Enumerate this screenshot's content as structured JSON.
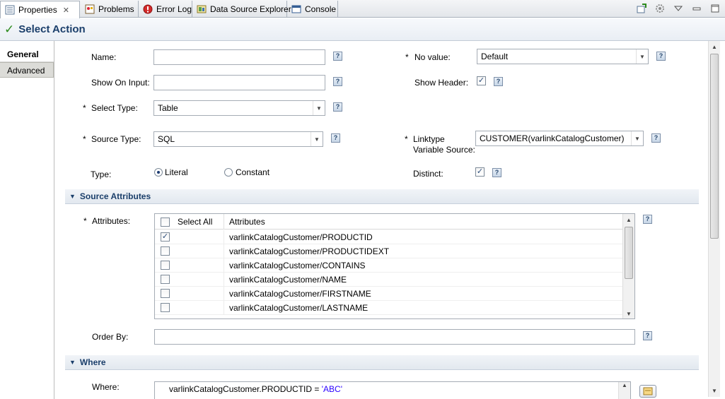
{
  "tabs": [
    {
      "label": "Properties",
      "icon": "properties-icon",
      "active": true,
      "closable": true
    },
    {
      "label": "Problems",
      "icon": "problems-icon"
    },
    {
      "label": "Error Log",
      "icon": "error-log-icon"
    },
    {
      "label": "Data Source Explorer",
      "icon": "data-source-explorer-icon"
    },
    {
      "label": "Console",
      "icon": "console-icon"
    }
  ],
  "title": "Select Action",
  "left_tabs": [
    {
      "label": "General",
      "selected": true
    },
    {
      "label": "Advanced",
      "selected": false
    }
  ],
  "form": {
    "name_label": "Name:",
    "name_value": "",
    "show_on_input_label": "Show On Input:",
    "show_on_input_value": "",
    "select_type_label": "Select Type:",
    "select_type_value": "Table",
    "source_type_label": "Source Type:",
    "source_type_value": "SQL",
    "type_label": "Type:",
    "type_options": [
      "Literal",
      "Constant"
    ],
    "type_selected": "Literal",
    "no_value_label": "No value:",
    "no_value_value": "Default",
    "show_header_label": "Show Header:",
    "show_header_checked": true,
    "linktype_label_1": "Linktype",
    "linktype_label_2": "Variable Source:",
    "linktype_value": "CUSTOMER(varlinkCatalogCustomer)",
    "distinct_label": "Distinct:",
    "distinct_checked": true,
    "required_mark": "*"
  },
  "source_attributes": {
    "section_title": "Source Attributes",
    "attributes_label": "Attributes:",
    "columns": [
      "Select All",
      "Attributes"
    ],
    "rows": [
      {
        "checked": true,
        "attribute": "varlinkCatalogCustomer/PRODUCTID"
      },
      {
        "checked": false,
        "attribute": "varlinkCatalogCustomer/PRODUCTIDEXT"
      },
      {
        "checked": false,
        "attribute": "varlinkCatalogCustomer/CONTAINS"
      },
      {
        "checked": false,
        "attribute": "varlinkCatalogCustomer/NAME"
      },
      {
        "checked": false,
        "attribute": "varlinkCatalogCustomer/FIRSTNAME"
      },
      {
        "checked": false,
        "attribute": "varlinkCatalogCustomer/LASTNAME"
      }
    ],
    "order_by_label": "Order By:",
    "order_by_value": ""
  },
  "where": {
    "section_title": "Where",
    "where_label": "Where:",
    "expression_prefix": "varlinkCatalogCustomer.PRODUCTID = ",
    "expression_string": "'ABC'"
  },
  "help_glyph": "?",
  "check_glyph": "✓"
}
